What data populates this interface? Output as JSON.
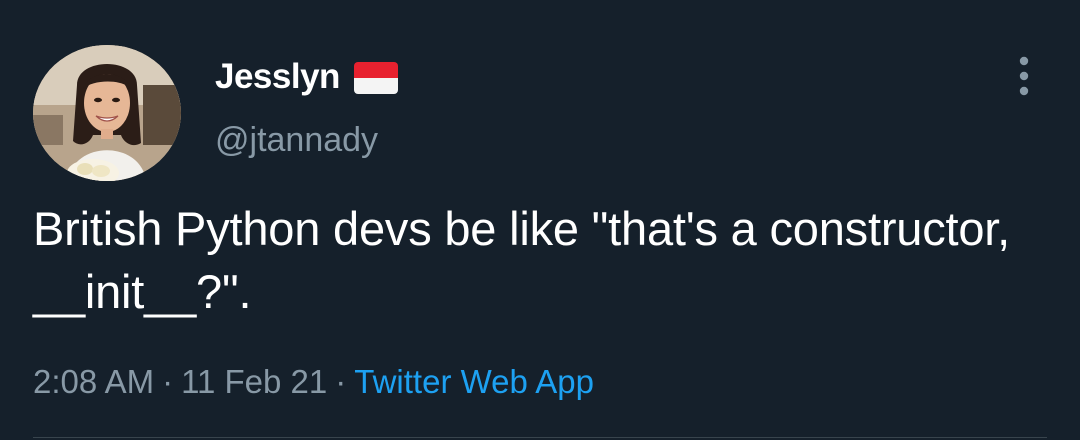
{
  "author": {
    "display_name": "Jesslyn",
    "handle": "@jtannady",
    "flag_icon": "indonesia-flag-icon",
    "avatar_icon": "profile-photo"
  },
  "tweet": {
    "text": "British Python devs be like \"that's a constructor, __init__?\".",
    "time": "2:08 AM",
    "date": "11 Feb 21",
    "separator": "·",
    "source": "Twitter Web App"
  },
  "menu": {
    "icon": "more-vertical-icon"
  },
  "colors": {
    "background": "#15202b",
    "primary_text": "#ffffff",
    "secondary_text": "#8899a6",
    "link": "#1da1f2",
    "divider": "#38444d"
  }
}
